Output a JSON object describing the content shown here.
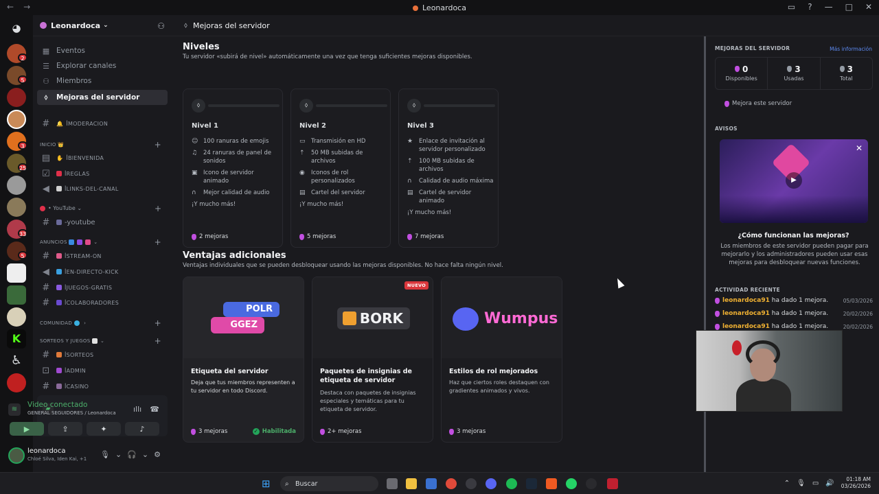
{
  "window": {
    "title": "Leonardoca"
  },
  "server": {
    "name": "Leonardoca"
  },
  "sidebar": {
    "items": [
      {
        "icon": "calendar-icon",
        "label": "Eventos"
      },
      {
        "icon": "compass-icon",
        "label": "Explorar canales"
      },
      {
        "icon": "members-icon",
        "label": "Miembros"
      },
      {
        "icon": "boost-icon",
        "label": "Mejoras del servidor"
      }
    ],
    "channels_top": [
      {
        "label": "MODERACION",
        "emoji": "🔔"
      }
    ],
    "categories": [
      {
        "label": "INICIO",
        "channels": [
          {
            "label": "BIENVENIDA"
          },
          {
            "label": "REGLAS"
          },
          {
            "label": "LINKS-DEL-CANAL"
          }
        ]
      },
      {
        "label": "YouTube",
        "channels": [
          {
            "label": "-youtube"
          }
        ]
      },
      {
        "label": "ANUNCIOS",
        "channels": [
          {
            "label": "STREAM-ON"
          },
          {
            "label": "EN-DIRECTO-KICK"
          },
          {
            "label": "JUEGOS-GRATIS"
          },
          {
            "label": "COLABORADORES"
          }
        ]
      },
      {
        "label": "COMUNIDAD"
      },
      {
        "label": "SORTEOS Y JUEGOS",
        "channels": [
          {
            "label": "SORTEOS"
          },
          {
            "label": "ADMIN"
          },
          {
            "label": "CASINO"
          }
        ]
      }
    ]
  },
  "voice": {
    "status": "Video conectado",
    "channel": "GENERAL SEGUIDORES / Leonardoca"
  },
  "user": {
    "name": "leonardoca",
    "status": "Chloé Silva, Iden Kai, +1"
  },
  "main": {
    "header": "Mejoras del servidor",
    "levels_title": "Niveles",
    "levels_desc": "Tu servidor «subirá de nivel» automáticamente una vez que tenga suficientes mejoras disponibles.",
    "levels": [
      {
        "name": "Nivel 1",
        "features": [
          {
            "icon": "emoji-icon",
            "text": "100 ranuras de emojis"
          },
          {
            "icon": "sound-icon",
            "text": "24 ranuras de panel de sonidos"
          },
          {
            "icon": "gif-icon",
            "text": "Icono de servidor animado"
          },
          {
            "icon": "headphones-icon",
            "text": "Mejor calidad de audio"
          }
        ],
        "more": "¡Y mucho más!",
        "cost": "2 mejoras"
      },
      {
        "name": "Nivel 2",
        "features": [
          {
            "icon": "screen-icon",
            "text": "Transmisión en HD"
          },
          {
            "icon": "upload-icon",
            "text": "50 MB subidas de archivos"
          },
          {
            "icon": "role-icon",
            "text": "Iconos de rol personalizados"
          },
          {
            "icon": "banner-icon",
            "text": "Cartel del servidor"
          }
        ],
        "more": "¡Y mucho más!",
        "cost": "5 mejoras"
      },
      {
        "name": "Nivel 3",
        "features": [
          {
            "icon": "star-icon",
            "text": "Enlace de invitación al servidor personalizado"
          },
          {
            "icon": "upload-icon",
            "text": "100 MB subidas de archivos"
          },
          {
            "icon": "headphones-icon",
            "text": "Calidad de audio máxima"
          },
          {
            "icon": "banner-icon",
            "text": "Cartel de servidor animado"
          }
        ],
        "more": "¡Y mucho más!",
        "cost": "7 mejoras"
      }
    ],
    "perks_title": "Ventajas adicionales",
    "perks_desc": "Ventajas individuales que se pueden desbloquear usando las mejoras disponibles. No hace falta ningún nivel.",
    "perks": [
      {
        "title": "Etiqueta del servidor",
        "desc": "Deja que tus miembros representen a tu servidor en todo Discord.",
        "cost": "3 mejoras",
        "status": "Habilitada",
        "art1": "POLR",
        "art2": "GGEZ"
      },
      {
        "title": "Paquetes de insignias de etiqueta de servidor",
        "desc": "Destaca con paquetes de insignias especiales y temáticas para tu etiqueta de servidor.",
        "cost": "2+ mejoras",
        "badge": "NUEVO",
        "art1": "BORK"
      },
      {
        "title": "Estilos de rol mejorados",
        "desc": "Haz que ciertos roles destaquen con gradientes animados y vivos.",
        "cost": "3 mejoras",
        "art1": "Wumpus"
      }
    ]
  },
  "right": {
    "boosts_title": "MEJORAS DEL SERVIDOR",
    "more_link": "Más información",
    "stats": [
      {
        "value": "0",
        "label": "Disponibles"
      },
      {
        "value": "3",
        "label": "Usadas"
      },
      {
        "value": "3",
        "label": "Total"
      }
    ],
    "boost_button": "Mejora este servidor",
    "notices_title": "AVISOS",
    "promo_title": "¿Cómo funcionan las mejoras?",
    "promo_desc": "Los miembros de este servidor pueden pagar para mejorarlo y los administradores pueden usar esas mejoras para desbloquear nuevas funciones.",
    "activity_title": "ACTIVIDAD RECIENTE",
    "activity": [
      {
        "user": "leonardoca91",
        "text": "ha dado 1 mejora.",
        "date": "05/03/2026"
      },
      {
        "user": "leonardoca91",
        "text": "ha dado 1 mejora.",
        "date": "20/02/2026"
      },
      {
        "user": "leonardoca91",
        "text": "ha dado 1 mejora.",
        "date": "20/02/2026"
      }
    ]
  },
  "taskbar": {
    "search": "Buscar",
    "time": "01:18 AM",
    "date": "03/26/2026"
  },
  "colors": {
    "accent": "#c14fe0",
    "online": "#23a55a",
    "link": "#5d8af0"
  }
}
